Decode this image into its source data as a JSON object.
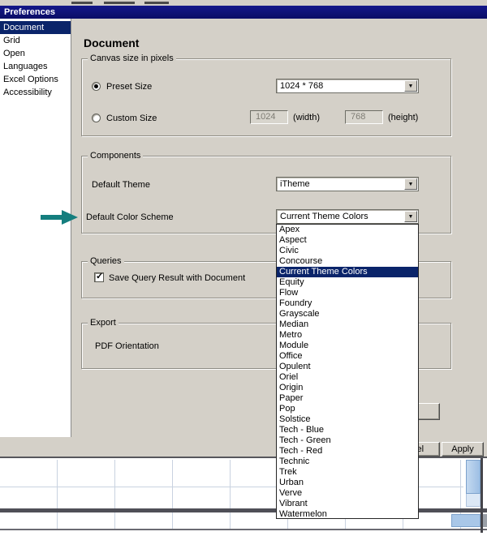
{
  "dialog": {
    "title": "Preferences"
  },
  "main": {
    "heading": "Document"
  },
  "icons": {
    "dropdown_arrow": "▼",
    "checkmark": "✓"
  },
  "sidebar": {
    "items": [
      {
        "label": "Document",
        "selected": true
      },
      {
        "label": "Grid",
        "selected": false
      },
      {
        "label": "Open",
        "selected": false
      },
      {
        "label": "Languages",
        "selected": false
      },
      {
        "label": "Excel Options",
        "selected": false
      },
      {
        "label": "Accessibility",
        "selected": false
      }
    ]
  },
  "canvas_group": {
    "title": "Canvas size in pixels",
    "preset_label": "Preset Size",
    "preset_value": "1024 * 768",
    "custom_label": "Custom Size",
    "width_value": "1024",
    "width_suffix": "(width)",
    "height_value": "768",
    "height_suffix": "(height)"
  },
  "components_group": {
    "title": "Components",
    "theme_label": "Default Theme",
    "theme_value": "iTheme",
    "scheme_label": "Default Color Scheme",
    "scheme_value": "Current Theme Colors"
  },
  "color_scheme_dropdown": {
    "options": [
      {
        "label": "Apex"
      },
      {
        "label": "Aspect"
      },
      {
        "label": "Civic"
      },
      {
        "label": "Concourse"
      },
      {
        "label": "Current Theme Colors",
        "selected": true
      },
      {
        "label": "Equity"
      },
      {
        "label": "Flow"
      },
      {
        "label": "Foundry"
      },
      {
        "label": "Grayscale"
      },
      {
        "label": "Median"
      },
      {
        "label": "Metro"
      },
      {
        "label": "Module"
      },
      {
        "label": "Office"
      },
      {
        "label": "Opulent"
      },
      {
        "label": "Oriel"
      },
      {
        "label": "Origin"
      },
      {
        "label": "Paper"
      },
      {
        "label": "Pop"
      },
      {
        "label": "Solstice"
      },
      {
        "label": "Tech - Blue"
      },
      {
        "label": "Tech - Green"
      },
      {
        "label": "Tech - Red"
      },
      {
        "label": "Technic"
      },
      {
        "label": "Trek"
      },
      {
        "label": "Urban"
      },
      {
        "label": "Verve"
      },
      {
        "label": "Vibrant"
      },
      {
        "label": "Watermelon"
      }
    ]
  },
  "queries_group": {
    "title": "Queries",
    "checkbox_label": "Save Query Result with Document",
    "checkbox_checked": true
  },
  "export_group": {
    "title": "Export",
    "pdf_label": "PDF Orientation"
  },
  "footer": {
    "cancel_label": "Cancel",
    "apply_label": "Apply"
  },
  "colors": {
    "titlebar": "#14188a",
    "selection": "#0a246a",
    "dialog_bg": "#d4d0c8",
    "annotation_arrow": "#147e7e",
    "scrollbar_blue": "#9dbfe4"
  }
}
